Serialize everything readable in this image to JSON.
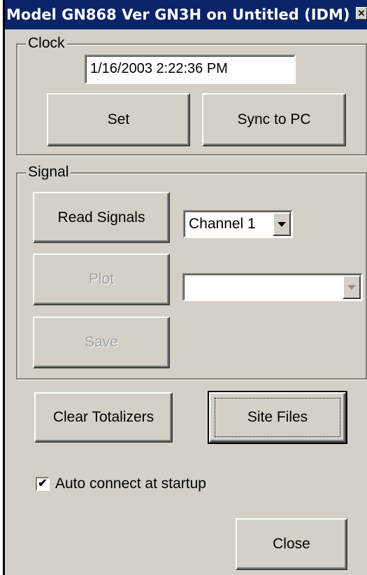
{
  "window": {
    "title": "Model GN868 Ver GN3H on Untitled (IDM) ...",
    "close_glyph": "×"
  },
  "clock": {
    "group_label": "Clock",
    "datetime_value": "1/16/2003 2:22:36 PM",
    "set_label": "Set",
    "sync_label": "Sync to PC"
  },
  "signal": {
    "group_label": "Signal",
    "read_label": "Read Signals",
    "plot_label": "Plot",
    "save_label": "Save",
    "channel_selected": "Channel 1",
    "secondary_selected": ""
  },
  "actions": {
    "clear_totalizers_label": "Clear Totalizers",
    "site_files_label": "Site Files"
  },
  "auto_connect": {
    "label": "Auto connect at startup",
    "checked": true,
    "check_glyph": "✔"
  },
  "footer": {
    "close_label": "Close"
  },
  "colors": {
    "titlebar": "#0a246a",
    "face": "#d4d0c8",
    "disabled_text": "#a0a0a0"
  }
}
